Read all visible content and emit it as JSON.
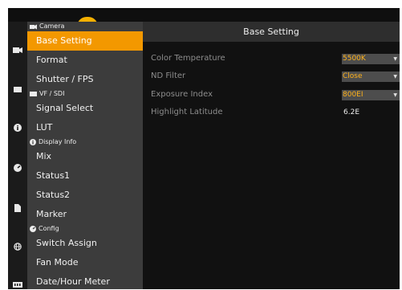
{
  "menu": {
    "groups": [
      {
        "label": "Camera",
        "icon": "camera-icon",
        "items": [
          "Base Setting",
          "Format",
          "Shutter / FPS"
        ]
      },
      {
        "label": "VF / SDI",
        "icon": "monitor-icon",
        "items": [
          "Signal Select",
          "LUT"
        ]
      },
      {
        "label": "Display Info",
        "icon": "info-icon",
        "items": [
          "Mix",
          "Status1",
          "Status2",
          "Marker"
        ]
      },
      {
        "label": "Config",
        "icon": "gauge-icon",
        "items": [
          "Switch Assign",
          "Fan Mode",
          "Date/Hour Meter"
        ]
      }
    ],
    "selected": "Base Setting"
  },
  "detail": {
    "title": "Base Setting",
    "rows": [
      {
        "label": "Color Temperature",
        "value": "5500K",
        "type": "select"
      },
      {
        "label": "ND Filter",
        "value": "Close",
        "type": "select"
      },
      {
        "label": "Exposure Index",
        "value": "800EI",
        "type": "select"
      },
      {
        "label": "Highlight Latitude",
        "value": "6.2E",
        "type": "text"
      }
    ]
  },
  "colors": {
    "accent": "#f39800",
    "value_text": "#ffb21a",
    "panel": "#3c3c3c",
    "background": "#111111"
  },
  "rail_icons": [
    "camera-icon",
    "monitor-icon",
    "info-icon",
    "gauge-icon",
    "document-icon",
    "globe-icon",
    "memory-card-icon"
  ]
}
